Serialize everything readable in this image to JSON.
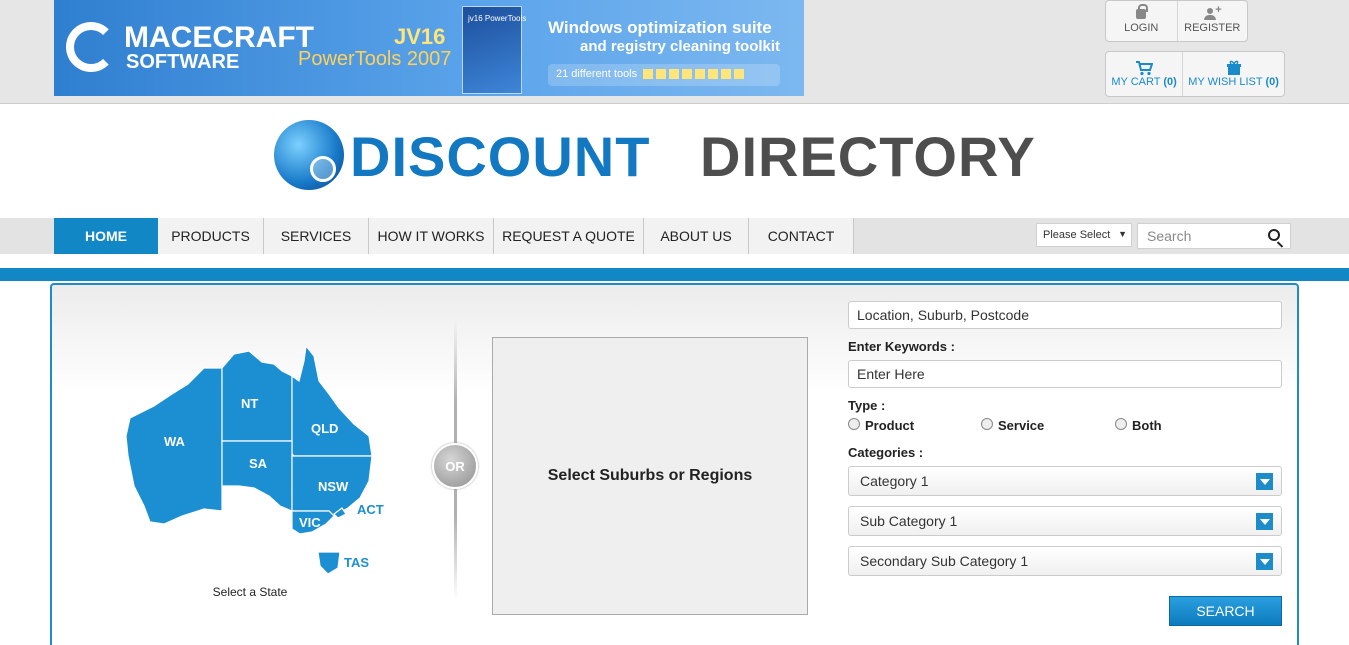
{
  "ad": {
    "brand_line1": "MACECRAFT",
    "brand_line2": "SOFTWARE",
    "product_line1": "JV16",
    "product_line2": "PowerTools 2007",
    "box_label": "jv16 PowerTools",
    "tagline1": "Windows optimization suite",
    "tagline2": "and registry cleaning toolkit",
    "tools_text": "21 different tools"
  },
  "account": {
    "login": "LOGIN",
    "register": "REGISTER",
    "cart_label": "MY CART",
    "cart_count": "(0)",
    "wish_label": "MY WISH LIST",
    "wish_count": "(0)"
  },
  "logo": {
    "word1": "DISCOUNT",
    "word2": "DIRECTORY"
  },
  "nav": {
    "items": [
      {
        "label": "HOME"
      },
      {
        "label": "PRODUCTS"
      },
      {
        "label": "SERVICES"
      },
      {
        "label": "HOW IT WORKS"
      },
      {
        "label": "REQUEST A QUOTE"
      },
      {
        "label": "ABOUT US"
      },
      {
        "label": "CONTACT"
      }
    ],
    "select_value": "Please Select",
    "search_placeholder": "Search"
  },
  "map": {
    "states": [
      "WA",
      "NT",
      "SA",
      "QLD",
      "NSW",
      "VIC",
      "ACT",
      "TAS"
    ],
    "caption": "Select a State"
  },
  "or_label": "OR",
  "regions_label": "Select Suburbs or Regions",
  "search_form": {
    "location_placeholder": "Location, Suburb, Postcode",
    "keywords_label": "Enter Keywords :",
    "keywords_placeholder": "Enter Here",
    "type_label": "Type :",
    "types": [
      "Product",
      "Service",
      "Both"
    ],
    "categories_label": "Categories :",
    "category": "Category 1",
    "sub_category": "Sub Category 1",
    "secondary_sub_category": "Secondary Sub Category 1",
    "search_button": "SEARCH"
  },
  "colors": {
    "accent": "#1187c6",
    "map_fill": "#1b8fd1",
    "outer_label": "#1b8fd1"
  }
}
